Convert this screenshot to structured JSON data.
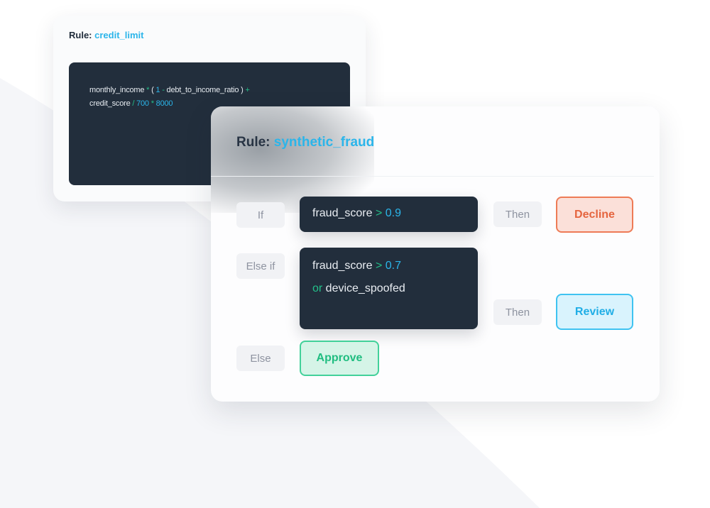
{
  "credit_limit_card": {
    "title_prefix": "Rule:",
    "rule_name": "credit_limit",
    "expression": {
      "line1": {
        "a": "monthly_income",
        "op1": " * ",
        "paren_open": "( ",
        "num1": "1",
        "op2": " - ",
        "b": "debt_to_income_ratio",
        "paren_close": " ) ",
        "op3": "+"
      },
      "line2": {
        "a": "credit_score",
        "op1": " / ",
        "num1": "700",
        "op2": " * ",
        "num2": "8000"
      }
    }
  },
  "synthetic_fraud_card": {
    "title_prefix": "Rule:",
    "rule_name": "synthetic_fraud",
    "rows": [
      {
        "keyword": "If",
        "condition": {
          "field": "fraud_score",
          "op": " > ",
          "value": "0.9"
        },
        "then_label": "Then",
        "outcome": "Decline"
      },
      {
        "keyword": "Else if",
        "condition": {
          "field": "fraud_score",
          "op": " > ",
          "value": "0.7",
          "connector": "or",
          "field2": " device_spoofed"
        },
        "then_label": "Then",
        "outcome": "Review"
      },
      {
        "keyword": "Else",
        "outcome": "Approve"
      }
    ]
  },
  "colors": {
    "accent_blue": "#2bb5ea",
    "operator_green": "#22c08a",
    "code_bg": "#222e3c",
    "decline": "#e5643e",
    "review": "#20aee6",
    "approve": "#1fbd80"
  }
}
